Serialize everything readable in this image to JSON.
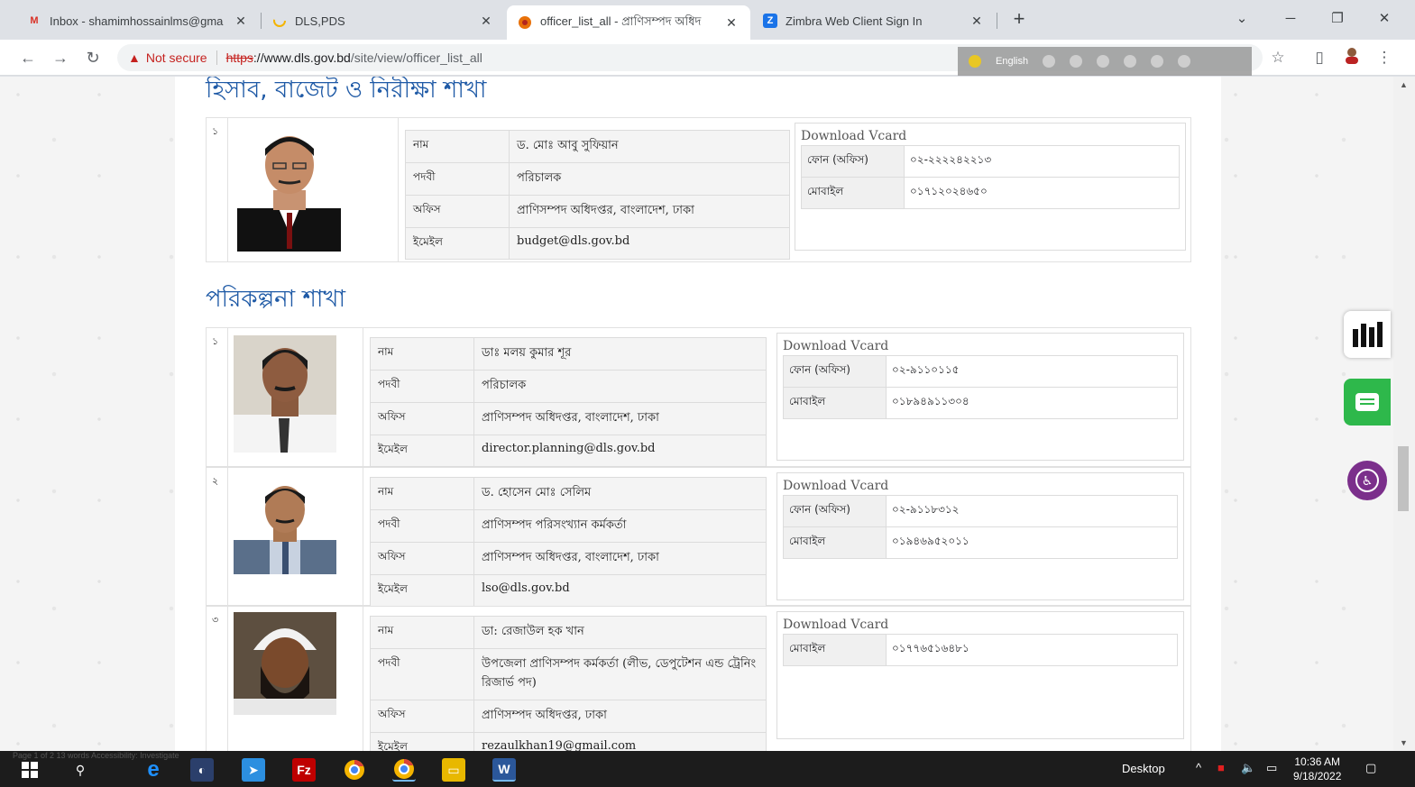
{
  "browser": {
    "tabs": [
      {
        "title": "Inbox - shamimhossainlms@gma",
        "icon": "gmail-icon",
        "active": false
      },
      {
        "title": "DLS,PDS",
        "icon": "loading-icon",
        "active": false
      },
      {
        "title": "officer_list_all - প্রাণিসম্পদ অধিদ",
        "icon": "site-favicon",
        "active": true
      },
      {
        "title": "Zimbra Web Client Sign In",
        "icon": "zimbra-icon",
        "active": false
      }
    ],
    "address": {
      "security_label": "Not secure",
      "scheme": "https",
      "host": "://www.dls.gov.bd",
      "path": "/site/view/officer_list_all"
    },
    "translate_language": "English"
  },
  "page": {
    "sections": [
      {
        "title": "হিসাব, বাজেট ও নিরীক্ষা শাখা",
        "officers": [
          {
            "serial": "১",
            "fields": [
              {
                "key": "নাম",
                "value": "ড. মোঃ আবু সুফিয়ান"
              },
              {
                "key": "পদবী",
                "value": "পরিচালক"
              },
              {
                "key": "অফিস",
                "value": "প্রাণিসম্পদ অধিদপ্তর, বাংলাদেশ, ঢাকা"
              },
              {
                "key": "ইমেইল",
                "value": "budget@dls.gov.bd"
              }
            ],
            "download_label": "Download Vcard",
            "contacts": [
              {
                "key": "ফোন (অফিস)",
                "value": "০২-২২২২৪২২১৩"
              },
              {
                "key": "মোবাইল",
                "value": "০১৭১২০২৪৬৫০"
              }
            ]
          }
        ]
      },
      {
        "title": "পরিকল্পনা শাখা",
        "officers": [
          {
            "serial": "১",
            "fields": [
              {
                "key": "নাম",
                "value": "ডাঃ মলয় কুমার শূর"
              },
              {
                "key": "পদবী",
                "value": "পরিচালক"
              },
              {
                "key": "অফিস",
                "value": "প্রাণিসম্পদ অধিদপ্তর, বাংলাদেশ, ঢাকা"
              },
              {
                "key": "ইমেইল",
                "value": "director.planning@dls.gov.bd"
              }
            ],
            "download_label": "Download Vcard",
            "contacts": [
              {
                "key": "ফোন (অফিস)",
                "value": "০২-৯১১০১১৫"
              },
              {
                "key": "মোবাইল",
                "value": "০১৮৯৪৯১১৩০৪"
              }
            ]
          },
          {
            "serial": "২",
            "fields": [
              {
                "key": "নাম",
                "value": "ড. হোসেন মোঃ সেলিম"
              },
              {
                "key": "পদবী",
                "value": "প্রাণিসম্পদ পরিসংখ্যান কর্মকর্তা"
              },
              {
                "key": "অফিস",
                "value": "প্রাণিসম্পদ অধিদপ্তর, বাংলাদেশ, ঢাকা"
              },
              {
                "key": "ইমেইল",
                "value": "lso@dls.gov.bd"
              }
            ],
            "download_label": "Download Vcard",
            "contacts": [
              {
                "key": "ফোন (অফিস)",
                "value": "০২-৯১১৮৩১২"
              },
              {
                "key": "মোবাইল",
                "value": "০১৯৪৬৯৫২০১১"
              }
            ]
          },
          {
            "serial": "৩",
            "fields": [
              {
                "key": "নাম",
                "value": "ডা: রেজাউল হক খান"
              },
              {
                "key": "পদবী",
                "value": "উপজেলা প্রাণিসম্পদ কর্মকর্তা (লীভ, ডেপুটেশন এন্ড ট্রেনিং রিজার্ভ পদ)"
              },
              {
                "key": "অফিস",
                "value": "প্রাণিসম্পদ অধিদপ্তর, ঢাকা"
              },
              {
                "key": "ইমেইল",
                "value": "rezaulkhan19@gmail.com"
              }
            ],
            "download_label": "Download Vcard",
            "contacts": [
              {
                "key": "মোবাইল",
                "value": "০১৭৭৬৫১৬৪৮১"
              }
            ]
          }
        ]
      }
    ]
  },
  "taskbar": {
    "status_text": "Page 1 of 2   13 words   Accessibility: Investigate",
    "desktop_label": "Desktop",
    "time": "10:36 AM",
    "date": "9/18/2022"
  },
  "colors": {
    "section_title": "#1f5aa6",
    "chat_button": "#2eb84b",
    "accessibility_button": "#7b2f8b",
    "not_secure": "#c5221f"
  }
}
